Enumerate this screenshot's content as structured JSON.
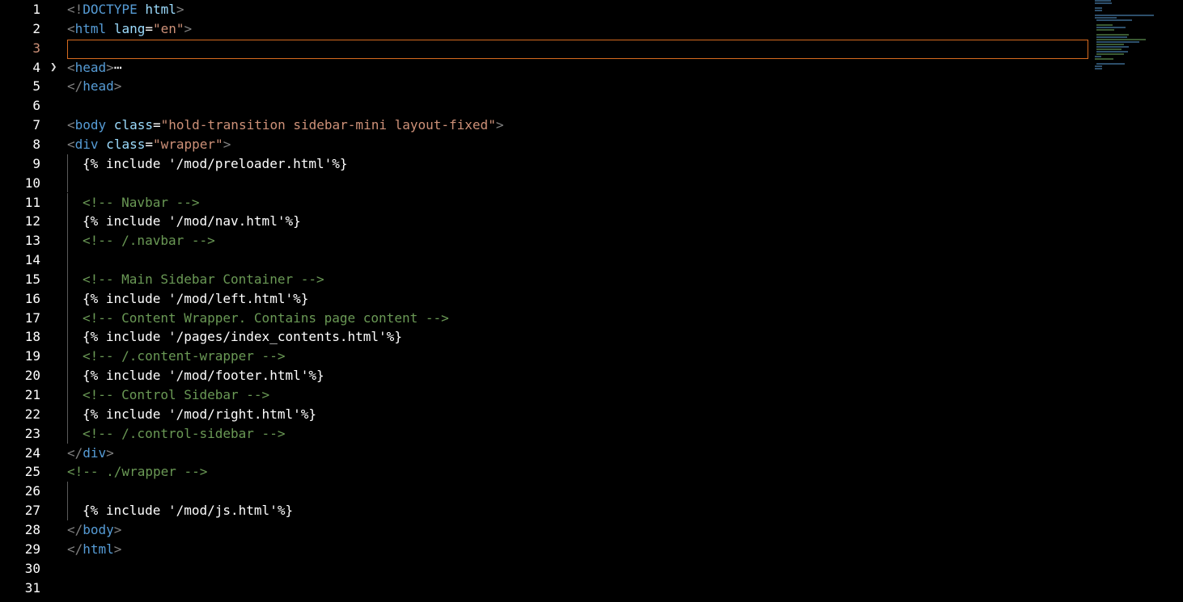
{
  "editor": {
    "active_line": 3,
    "lines": [
      {
        "n": "1",
        "indent": 0,
        "tokens": [
          {
            "t": "<!",
            "c": "bracket"
          },
          {
            "t": "DOCTYPE",
            "c": "tag"
          },
          {
            "t": " html",
            "c": "attr"
          },
          {
            "t": ">",
            "c": "bracket"
          }
        ]
      },
      {
        "n": "2",
        "indent": 0,
        "tokens": [
          {
            "t": "<",
            "c": "bracket"
          },
          {
            "t": "html",
            "c": "tag"
          },
          {
            "t": " lang",
            "c": "attr"
          },
          {
            "t": "=",
            "c": "txt"
          },
          {
            "t": "\"en\"",
            "c": "str"
          },
          {
            "t": ">",
            "c": "bracket"
          }
        ]
      },
      {
        "n": "3",
        "indent": 0,
        "tokens": []
      },
      {
        "n": "4",
        "indent": 0,
        "fold": true,
        "tokens": [
          {
            "t": "<",
            "c": "bracket"
          },
          {
            "t": "head",
            "c": "tag"
          },
          {
            "t": ">",
            "c": "bracket"
          },
          {
            "t": "⋯",
            "c": "ell"
          }
        ]
      },
      {
        "n": "5",
        "indent": 0,
        "tokens": [
          {
            "t": "</",
            "c": "bracket"
          },
          {
            "t": "head",
            "c": "tag"
          },
          {
            "t": ">",
            "c": "bracket"
          }
        ]
      },
      {
        "n": "6",
        "indent": 0,
        "tokens": []
      },
      {
        "n": "7",
        "indent": 0,
        "tokens": [
          {
            "t": "<",
            "c": "bracket"
          },
          {
            "t": "body",
            "c": "tag"
          },
          {
            "t": " class",
            "c": "attr"
          },
          {
            "t": "=",
            "c": "txt"
          },
          {
            "t": "\"hold-transition sidebar-mini layout-fixed\"",
            "c": "str"
          },
          {
            "t": ">",
            "c": "bracket"
          }
        ]
      },
      {
        "n": "8",
        "indent": 0,
        "tokens": [
          {
            "t": "<",
            "c": "bracket"
          },
          {
            "t": "div",
            "c": "tag"
          },
          {
            "t": " class",
            "c": "attr"
          },
          {
            "t": "=",
            "c": "txt"
          },
          {
            "t": "\"wrapper\"",
            "c": "str"
          },
          {
            "t": ">",
            "c": "bracket"
          }
        ]
      },
      {
        "n": "9",
        "indent": 1,
        "tokens": [
          {
            "t": "{% include '/mod/preloader.html'%}",
            "c": "txt"
          }
        ]
      },
      {
        "n": "10",
        "indent": 1,
        "tokens": []
      },
      {
        "n": "11",
        "indent": 1,
        "tokens": [
          {
            "t": "<!-- Navbar -->",
            "c": "cmt"
          }
        ]
      },
      {
        "n": "12",
        "indent": 1,
        "tokens": [
          {
            "t": "{% include '/mod/nav.html'%}",
            "c": "txt"
          }
        ]
      },
      {
        "n": "13",
        "indent": 1,
        "tokens": [
          {
            "t": "<!-- /.navbar -->",
            "c": "cmt"
          }
        ]
      },
      {
        "n": "14",
        "indent": 1,
        "tokens": []
      },
      {
        "n": "15",
        "indent": 1,
        "tokens": [
          {
            "t": "<!-- Main Sidebar Container -->",
            "c": "cmt"
          }
        ]
      },
      {
        "n": "16",
        "indent": 1,
        "tokens": [
          {
            "t": "{% include '/mod/left.html'%}",
            "c": "txt"
          }
        ]
      },
      {
        "n": "17",
        "indent": 1,
        "tokens": [
          {
            "t": "<!-- Content Wrapper. Contains page content -->",
            "c": "cmt"
          }
        ]
      },
      {
        "n": "18",
        "indent": 1,
        "tokens": [
          {
            "t": "{% include '/pages/index_contents.html'%}",
            "c": "txt"
          }
        ]
      },
      {
        "n": "19",
        "indent": 1,
        "tokens": [
          {
            "t": "<!-- /.content-wrapper -->",
            "c": "cmt"
          }
        ]
      },
      {
        "n": "20",
        "indent": 1,
        "tokens": [
          {
            "t": "{% include '/mod/footer.html'%}",
            "c": "txt"
          }
        ]
      },
      {
        "n": "21",
        "indent": 1,
        "tokens": [
          {
            "t": "<!-- Control Sidebar -->",
            "c": "cmt"
          }
        ]
      },
      {
        "n": "22",
        "indent": 1,
        "tokens": [
          {
            "t": "{% include '/mod/right.html'%}",
            "c": "txt"
          }
        ]
      },
      {
        "n": "23",
        "indent": 1,
        "tokens": [
          {
            "t": "<!-- /.control-sidebar -->",
            "c": "cmt"
          }
        ]
      },
      {
        "n": "24",
        "indent": 0,
        "tokens": [
          {
            "t": "</",
            "c": "bracket"
          },
          {
            "t": "div",
            "c": "tag"
          },
          {
            "t": ">",
            "c": "bracket"
          }
        ]
      },
      {
        "n": "25",
        "indent": 0,
        "tokens": [
          {
            "t": "<!-- ./wrapper -->",
            "c": "cmt"
          }
        ]
      },
      {
        "n": "26",
        "indent": 1,
        "tokens": []
      },
      {
        "n": "27",
        "indent": 1,
        "tokens": [
          {
            "t": "{% include '/mod/js.html'%}",
            "c": "txt"
          }
        ]
      },
      {
        "n": "28",
        "indent": 0,
        "tokens": [
          {
            "t": "</",
            "c": "bracket"
          },
          {
            "t": "body",
            "c": "tag"
          },
          {
            "t": ">",
            "c": "bracket"
          }
        ]
      },
      {
        "n": "29",
        "indent": 0,
        "tokens": [
          {
            "t": "</",
            "c": "bracket"
          },
          {
            "t": "html",
            "c": "tag"
          },
          {
            "t": ">",
            "c": "bracket"
          }
        ]
      },
      {
        "n": "30",
        "indent": 0,
        "tokens": []
      },
      {
        "n": "31",
        "indent": 0,
        "tokens": []
      }
    ]
  }
}
